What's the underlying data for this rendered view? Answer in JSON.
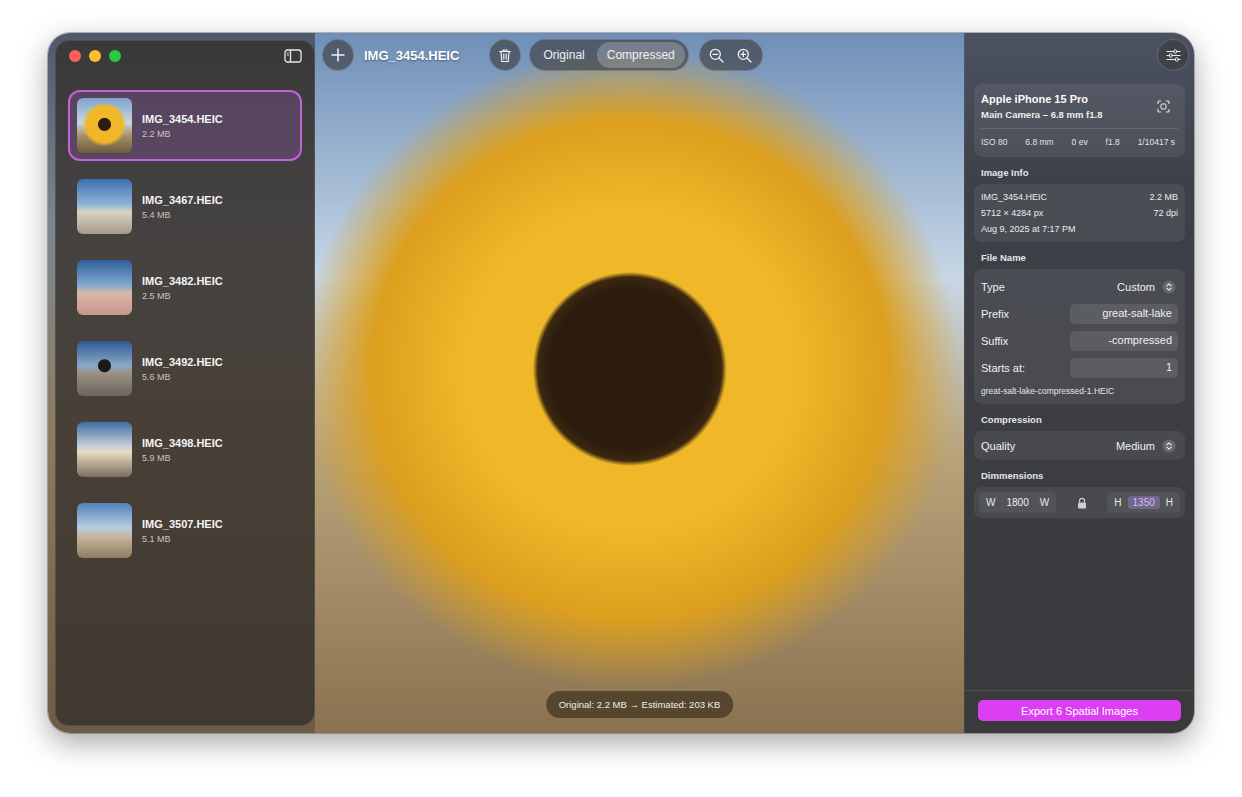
{
  "window": {
    "title": "IMG_3454.HEIC"
  },
  "toolbar": {
    "view_modes": [
      {
        "label": "Original",
        "selected": false
      },
      {
        "label": "Compressed",
        "selected": true
      }
    ]
  },
  "files": [
    {
      "name": "IMG_3454.HEIC",
      "size": "2.2 MB",
      "selected": true
    },
    {
      "name": "IMG_3467.HEIC",
      "size": "5.4 MB",
      "selected": false
    },
    {
      "name": "IMG_3482.HEIC",
      "size": "2.5 MB",
      "selected": false
    },
    {
      "name": "IMG_3492.HEIC",
      "size": "5.6 MB",
      "selected": false
    },
    {
      "name": "IMG_3498.HEIC",
      "size": "5.9 MB",
      "selected": false
    },
    {
      "name": "IMG_3507.HEIC",
      "size": "5.1 MB",
      "selected": false
    }
  ],
  "camera": {
    "model": "Apple iPhone 15 Pro",
    "lens": "Main Camera – 6.8 mm f1.8",
    "specs": [
      "ISO 80",
      "6.8 mm",
      "0 ev",
      "f1.8",
      "1/10417 s"
    ]
  },
  "image_info": {
    "heading": "Image Info",
    "name": "IMG_3454.HEIC",
    "size": "2.2 MB",
    "dimensions": "5712 × 4284 px",
    "dpi": "72 dpi",
    "date": "Aug 9, 2025 at 7:17 PM"
  },
  "file_name": {
    "heading": "File Name",
    "fields": [
      {
        "label": "Type",
        "value": "Custom",
        "kind": "select"
      },
      {
        "label": "Prefix",
        "value": "great-salt-lake",
        "kind": "text"
      },
      {
        "label": "Suffix",
        "value": "-compressed",
        "kind": "text"
      },
      {
        "label": "Starts at:",
        "value": "1",
        "kind": "text"
      }
    ],
    "preview": "great-salt-lake-compressed-1.HEIC"
  },
  "compression": {
    "heading": "Compression",
    "label": "Quality",
    "value": "Medium"
  },
  "dimensions": {
    "heading": "Dimmensions",
    "width": {
      "label": "W",
      "value": "1800",
      "unit": "W",
      "selected": false
    },
    "height": {
      "label": "H",
      "value": "1350",
      "unit": "H",
      "selected": true
    },
    "locked": true
  },
  "status": "Original: 2.2 MB → Estimated: 203 KB",
  "export_button": "Export 6 Spatial Images"
}
